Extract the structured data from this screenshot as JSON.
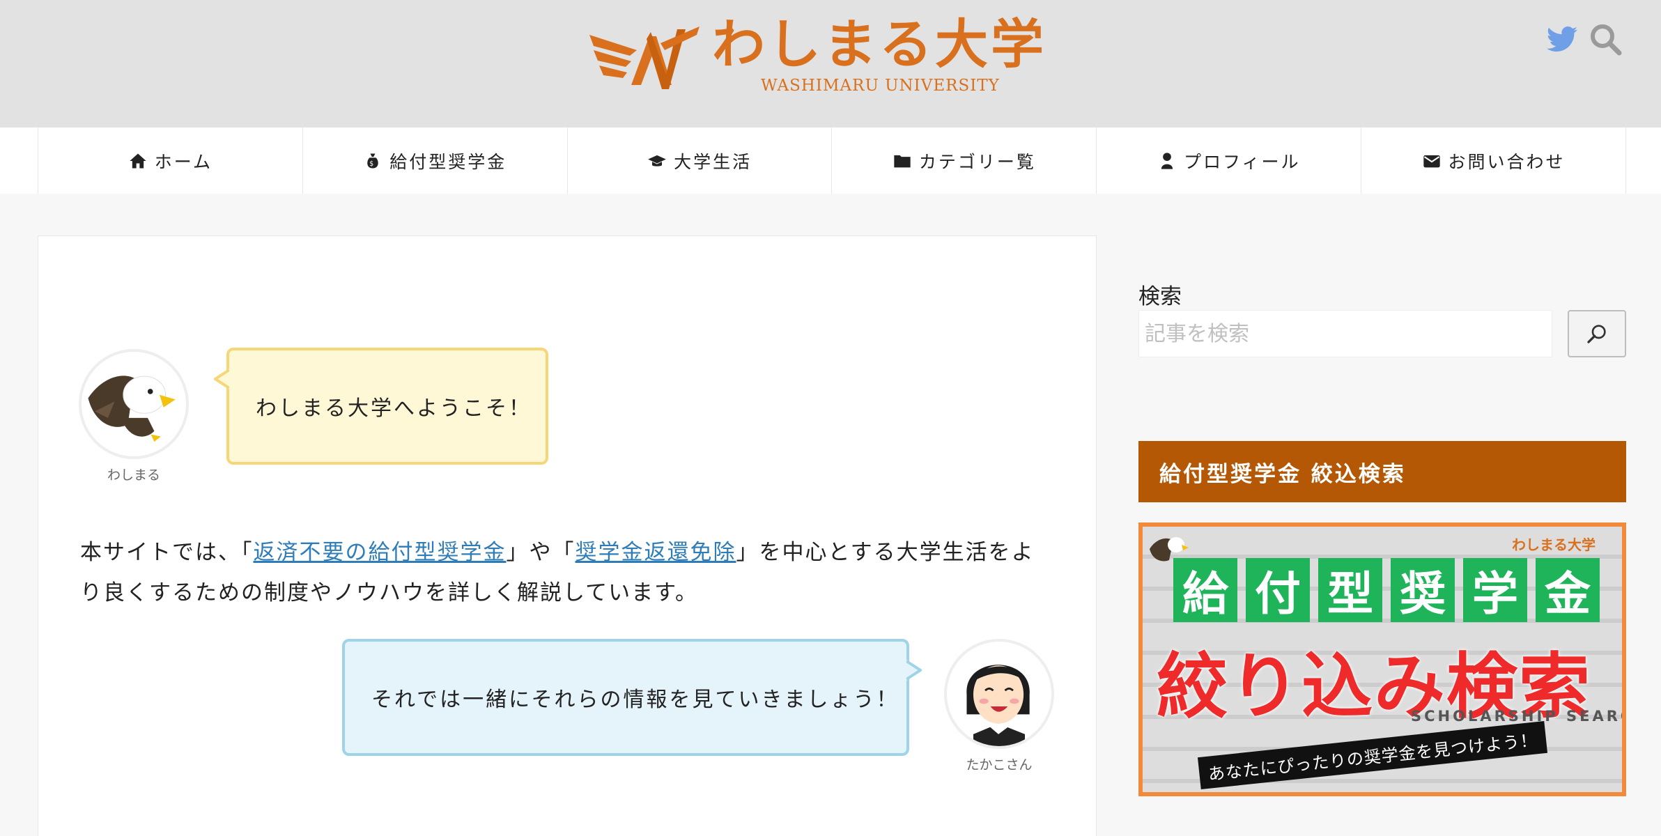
{
  "header": {
    "logo_title": "わしまる大学",
    "logo_subtitle": "WASHIMARU UNIVERSITY",
    "twitter_icon": "twitter-icon",
    "search_icon": "search-icon"
  },
  "nav": {
    "items": [
      {
        "label": "ホーム",
        "icon": "home-icon"
      },
      {
        "label": "給付型奨学金",
        "icon": "money-bag-icon"
      },
      {
        "label": "大学生活",
        "icon": "graduation-cap-icon"
      },
      {
        "label": "カテゴリー覧",
        "icon": "folder-icon"
      },
      {
        "label": "プロフィール",
        "icon": "user-icon"
      },
      {
        "label": "お問い合わせ",
        "icon": "mail-icon"
      }
    ]
  },
  "main": {
    "balloon1": {
      "text": "わしまる大学へようこそ！",
      "speaker": "わしまる"
    },
    "intro": {
      "prefix": "本サイトでは、「",
      "link1": "返済不要の給付型奨学金",
      "mid": "」や「",
      "link2": "奨学金返還免除",
      "suffix": "」を中心とする大学生活をより良くするための制度やノウハウを詳しく解説しています。"
    },
    "balloon2": {
      "text": "それでは一緒にそれらの情報を見ていきましょう！",
      "speaker": "たかこさん"
    }
  },
  "sidebar": {
    "search_label": "検索",
    "search_placeholder": "記事を検索",
    "widget_title": "給付型奨学金 絞込検索",
    "banner": {
      "kanji": [
        "給",
        "付",
        "型",
        "奨",
        "学",
        "金"
      ],
      "main_text": "絞り込み検索",
      "en_text": "SCHOLARSHIP SEARCH",
      "ribbon_text": "あなたにぴったりの奨学金を見つけよう！",
      "logo_text": "わしまる大学"
    }
  },
  "colors": {
    "accent": "#d9701d",
    "widget_bg": "#b55806",
    "link": "#2e7db8",
    "twitter": "#6f9fe6"
  }
}
